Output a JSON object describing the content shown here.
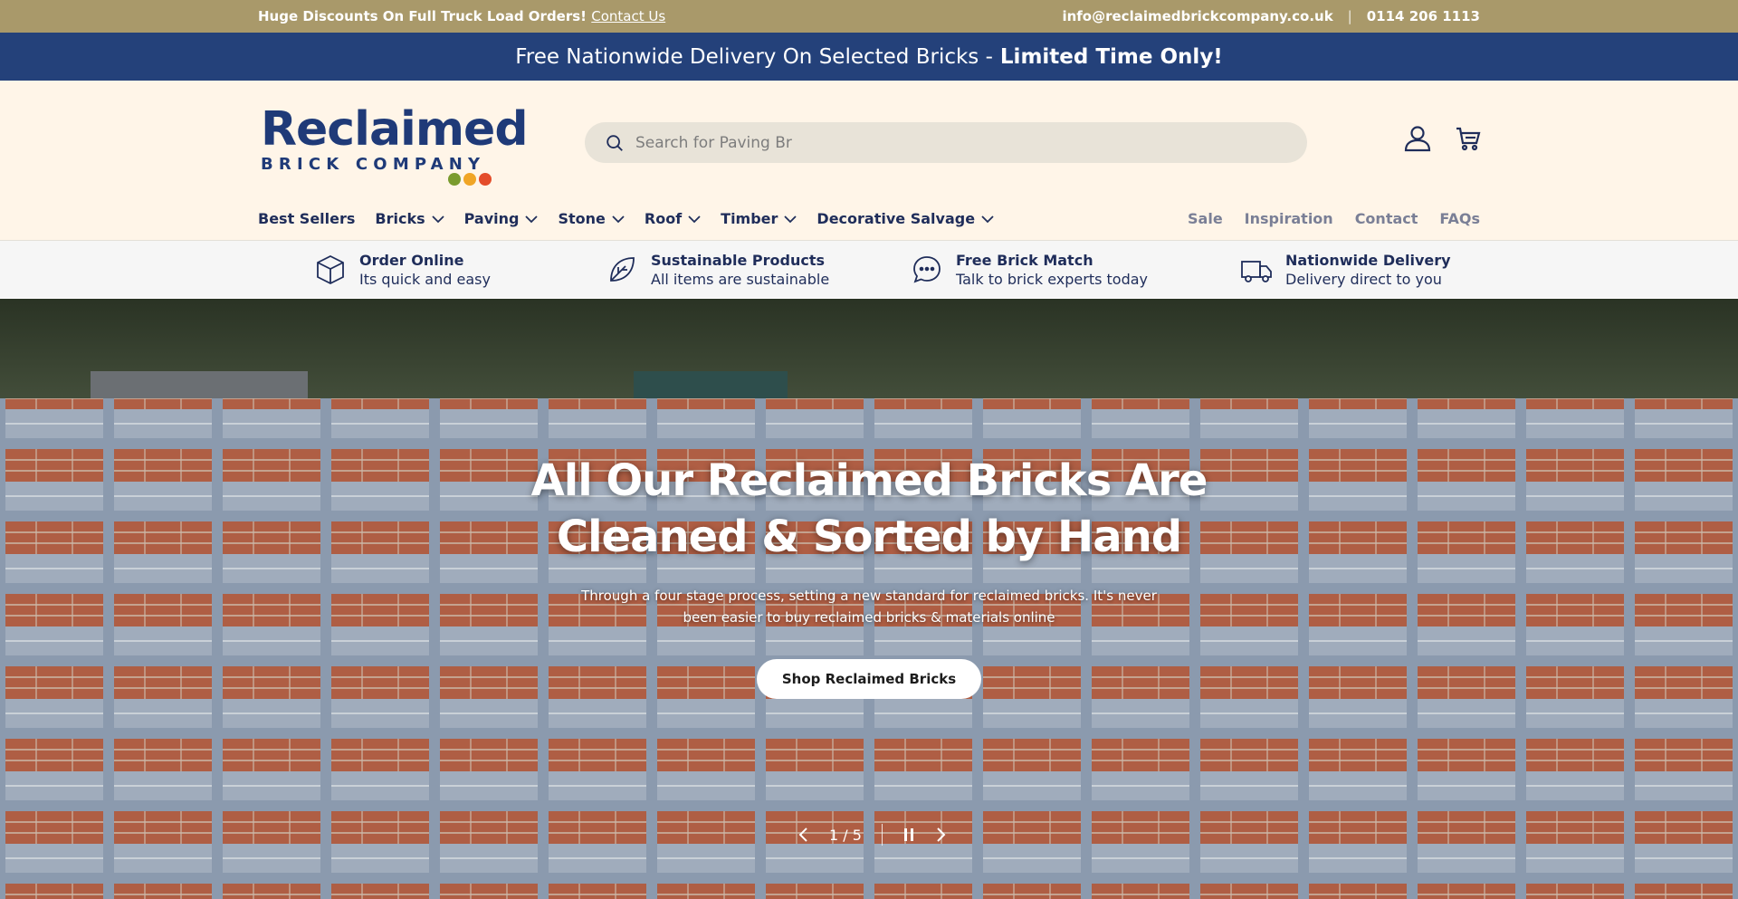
{
  "topbar": {
    "promo_text": "Huge Discounts On Full Truck Load Orders!",
    "contact_link": "Contact Us",
    "email": "info@reclaimedbrickcompany.co.uk",
    "separator": "|",
    "phone": "0114 206 1113"
  },
  "promo_banner": {
    "text": "Free Nationwide Delivery On Selected Bricks -",
    "highlight": "Limited Time Only!"
  },
  "logo": {
    "main": "Reclaimed",
    "sub": "BRICK COMPANY",
    "dot_colors": [
      "#7a9b2e",
      "#f0a526",
      "#e44c2a"
    ]
  },
  "search": {
    "placeholder": "Search for Paving Br"
  },
  "nav": {
    "items": [
      {
        "label": "Best Sellers",
        "dropdown": false
      },
      {
        "label": "Bricks",
        "dropdown": true
      },
      {
        "label": "Paving",
        "dropdown": true
      },
      {
        "label": "Stone",
        "dropdown": true
      },
      {
        "label": "Roof",
        "dropdown": true
      },
      {
        "label": "Timber",
        "dropdown": true
      },
      {
        "label": "Decorative Salvage",
        "dropdown": true
      }
    ],
    "right_items": [
      "Sale",
      "Inspiration",
      "Contact",
      "FAQs"
    ]
  },
  "features": [
    {
      "icon": "box-icon",
      "title": "Order Online",
      "subtitle": "Its quick and easy"
    },
    {
      "icon": "leaf-icon",
      "title": "Sustainable Products",
      "subtitle": "All items are sustainable"
    },
    {
      "icon": "chat-icon",
      "title": "Free Brick Match",
      "subtitle": "Talk to brick experts today"
    },
    {
      "icon": "truck-icon",
      "title": "Nationwide Delivery",
      "subtitle": "Delivery direct to you"
    }
  ],
  "hero": {
    "title_line1": "All Our Reclaimed Bricks Are",
    "title_line2": "Cleaned & Sorted by Hand",
    "description": "Through a four stage process, setting a new standard for reclaimed bricks. It's never been easier to buy reclaimed bricks & materials online",
    "cta": "Shop Reclaimed Bricks",
    "slide_counter": "1 / 5"
  },
  "colors": {
    "topbar": "#a9996a",
    "promo": "#24417a",
    "header_bg": "#fff5e8",
    "brand": "#1f3a78"
  }
}
